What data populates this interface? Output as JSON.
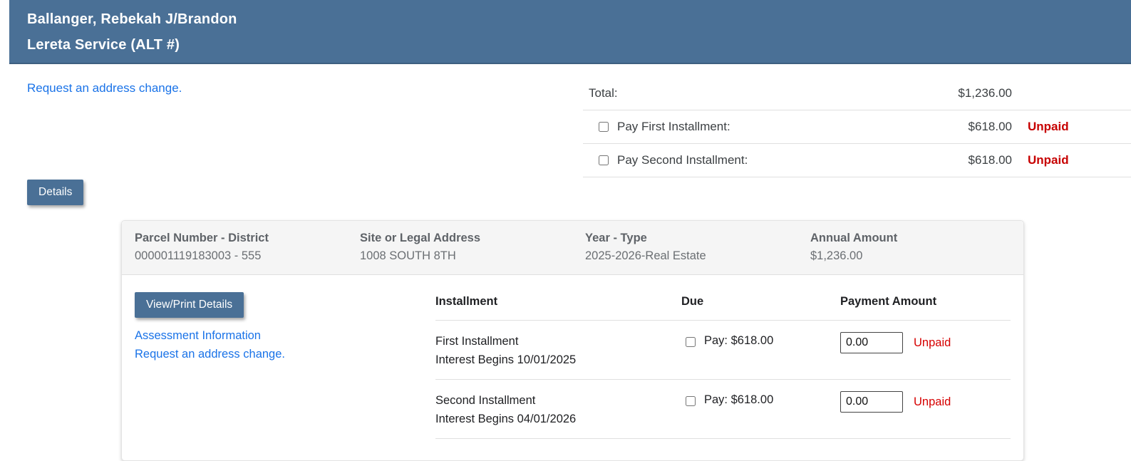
{
  "header": {
    "line1": "Ballanger, Rebekah J/Brandon",
    "line2": "Lereta Service (ALT #)"
  },
  "links": {
    "address_change": "Request an address change."
  },
  "totals": {
    "total_label": "Total:",
    "total_amount": "$1,236.00",
    "rows": [
      {
        "label": "Pay First Installment:",
        "amount": "$618.00",
        "status": "Unpaid",
        "checked": false
      },
      {
        "label": "Pay Second Installment:",
        "amount": "$618.00",
        "status": "Unpaid",
        "checked": false
      }
    ]
  },
  "details_button": "Details",
  "panel": {
    "summary": [
      {
        "label": "Parcel Number - District",
        "value": "000001119183003 - 555"
      },
      {
        "label": "Site or Legal Address",
        "value": "1008 SOUTH 8TH"
      },
      {
        "label": "Year - Type",
        "value": "2025-2026-Real Estate"
      },
      {
        "label": "Annual Amount",
        "value": "$1,236.00"
      }
    ],
    "actions": {
      "view_print": "View/Print Details",
      "assessment": "Assessment Information",
      "address_change": "Request an address change."
    },
    "table": {
      "headers": [
        "Installment",
        "Due",
        "Payment Amount"
      ],
      "rows": [
        {
          "name": "First Installment",
          "interest": "Interest Begins 10/01/2025",
          "due": "Pay: $618.00",
          "payment_value": "0.00",
          "status": "Unpaid",
          "checked": false
        },
        {
          "name": "Second Installment",
          "interest": "Interest Begins 04/01/2026",
          "due": "Pay: $618.00",
          "payment_value": "0.00",
          "status": "Unpaid",
          "checked": false
        }
      ]
    }
  },
  "colors": {
    "header_blue": "#4a7096",
    "button_blue": "#4a7096",
    "link_blue": "#1a73e8",
    "unpaid_red": "#c70000",
    "divider_gray": "#e0e0e0",
    "panel_header_bg": "#f5f5f5"
  }
}
